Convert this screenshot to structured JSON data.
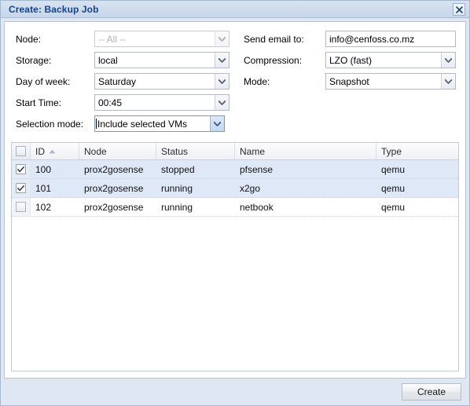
{
  "window": {
    "title": "Create: Backup Job",
    "close_icon": "close-icon"
  },
  "form": {
    "left": [
      {
        "label": "Node:",
        "value": "-- All --",
        "type": "combobox",
        "state": "disabled"
      },
      {
        "label": "Storage:",
        "value": "local",
        "type": "combobox",
        "state": "normal"
      },
      {
        "label": "Day of week:",
        "value": "Saturday",
        "type": "combobox",
        "state": "normal"
      },
      {
        "label": "Start Time:",
        "value": "00:45",
        "type": "combobox",
        "state": "normal"
      },
      {
        "label": "Selection mode:",
        "value": "Include selected VMs",
        "type": "combobox",
        "state": "focused"
      }
    ],
    "right": [
      {
        "label": "Send email to:",
        "value": "info@cenfoss.co.mz",
        "type": "textfield",
        "state": "normal"
      },
      {
        "label": "Compression:",
        "value": "LZO (fast)",
        "type": "combobox",
        "state": "normal"
      },
      {
        "label": "Mode:",
        "value": "Snapshot",
        "type": "combobox",
        "state": "normal"
      }
    ]
  },
  "grid": {
    "columns": [
      "ID",
      "Node",
      "Status",
      "Name",
      "Type"
    ],
    "sort": {
      "column": "ID",
      "direction": "asc"
    },
    "header_checkbox": false,
    "rows": [
      {
        "checked": true,
        "id": "100",
        "node": "prox2gosense",
        "status": "stopped",
        "name": "pfsense",
        "type": "qemu"
      },
      {
        "checked": true,
        "id": "101",
        "node": "prox2gosense",
        "status": "running",
        "name": "x2go",
        "type": "qemu"
      },
      {
        "checked": false,
        "id": "102",
        "node": "prox2gosense",
        "status": "running",
        "name": "netbook",
        "type": "qemu"
      }
    ]
  },
  "footer": {
    "create_label": "Create"
  },
  "colors": {
    "title_text": "#15428b",
    "window_bg": "#dfe8f2",
    "row_selected": "#dfe8f6"
  }
}
